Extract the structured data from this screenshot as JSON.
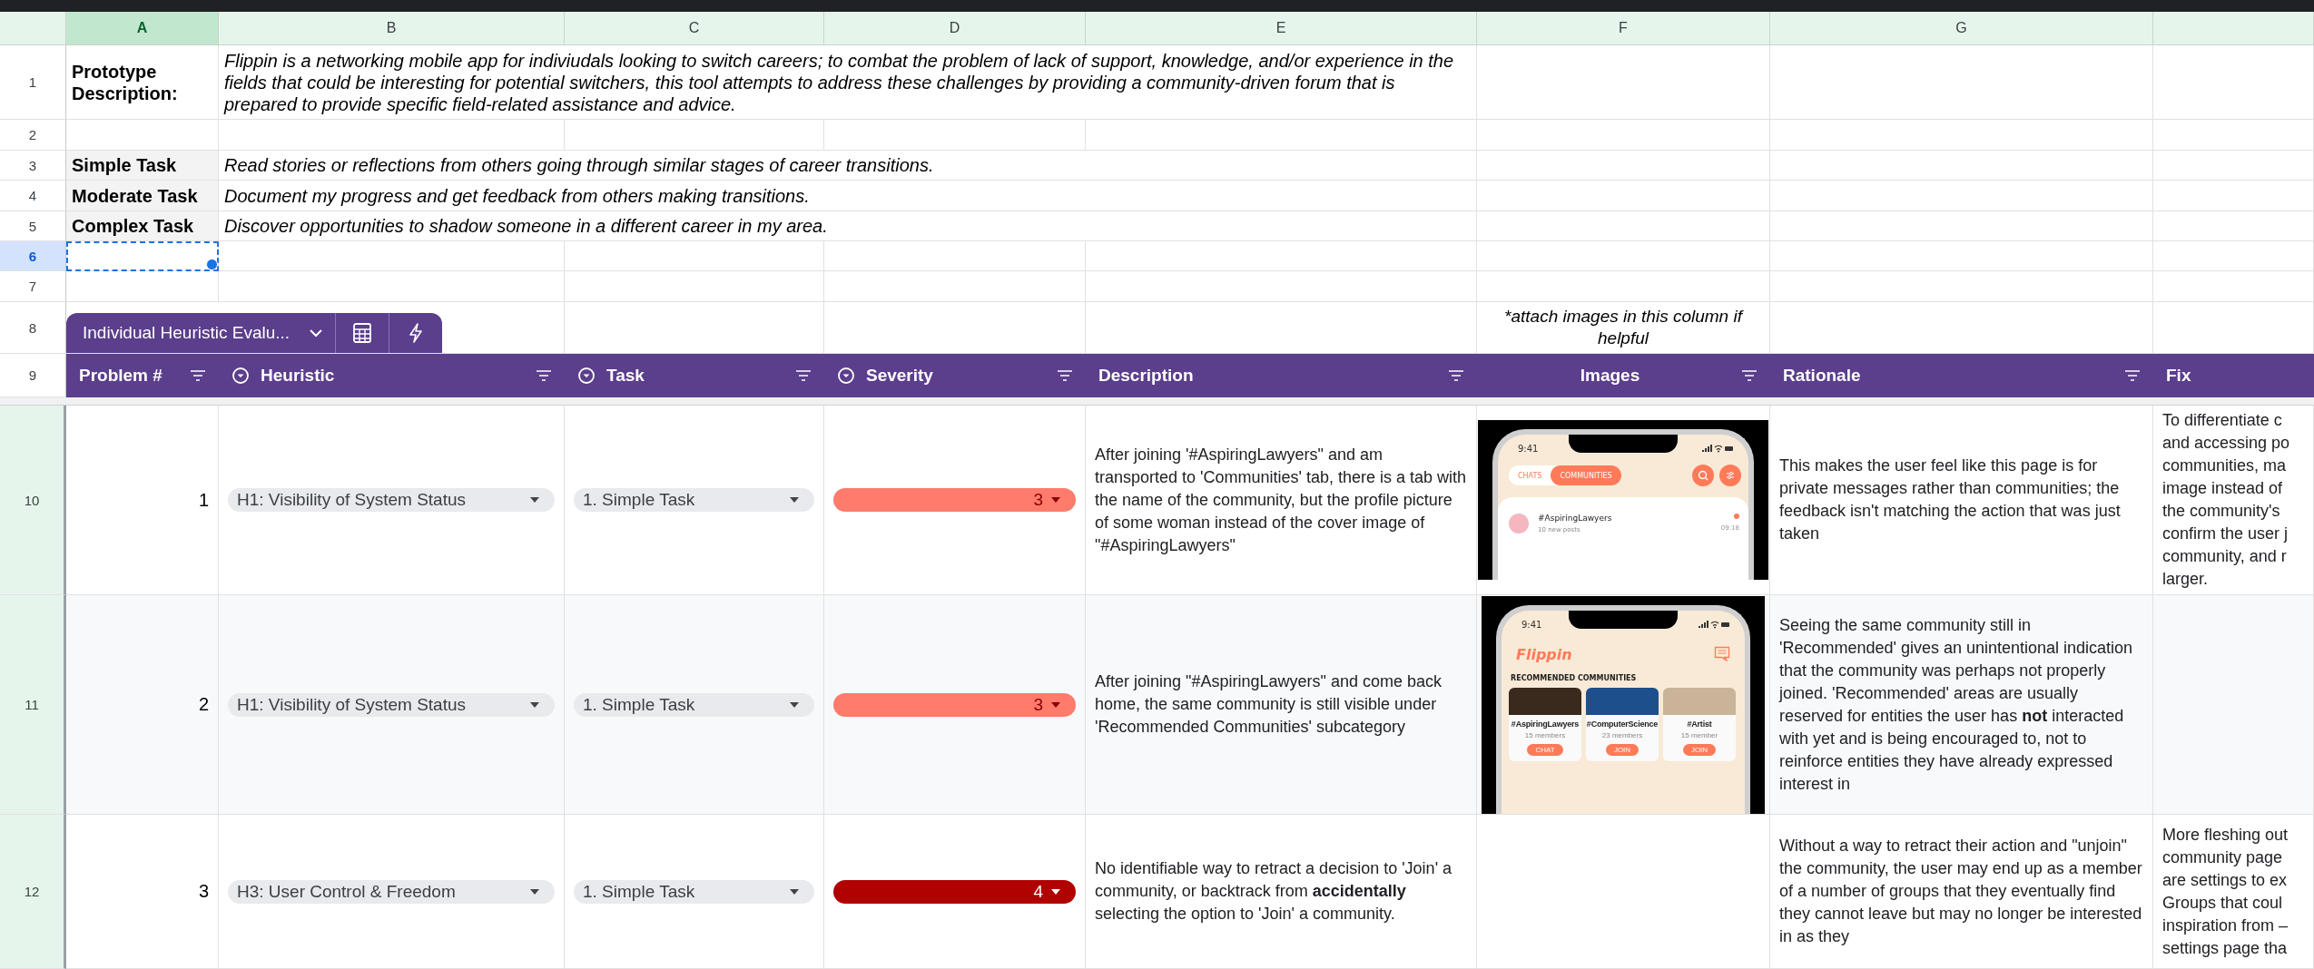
{
  "sheet": {
    "columns": [
      {
        "label": "A",
        "selected": true
      },
      {
        "label": "B",
        "selected": false
      },
      {
        "label": "C",
        "selected": false
      },
      {
        "label": "D",
        "selected": false
      },
      {
        "label": "E",
        "selected": false
      },
      {
        "label": "F",
        "selected": false
      },
      {
        "label": "G",
        "selected": false
      }
    ],
    "row_numbers": [
      {
        "label": "1",
        "selected": false
      },
      {
        "label": "2",
        "selected": false
      },
      {
        "label": "3",
        "selected": false
      },
      {
        "label": "4",
        "selected": false
      },
      {
        "label": "5",
        "selected": false
      },
      {
        "label": "6",
        "selected": true
      },
      {
        "label": "7",
        "selected": false
      },
      {
        "label": "8",
        "selected": false
      },
      {
        "label": "9",
        "selected": false
      },
      {
        "label": "10",
        "selected": false
      },
      {
        "label": "11",
        "selected": false
      },
      {
        "label": "12",
        "selected": false
      }
    ]
  },
  "intro": {
    "label": "Prototype Description:",
    "text": "Flippin is a networking mobile app for indiviudals looking to switch careers; to combat the problem of lack of support, knowledge, and/or experience in the fields that could be interesting for potential switchers, this tool attempts to address these challenges by providing a community-driven forum that is prepared to provide specific field-related assistance and advice."
  },
  "tasks": [
    {
      "label": "Simple Task",
      "text": "Read stories or reflections from others going through similar stages of career transitions."
    },
    {
      "label": "Moderate Task",
      "text": "Document my progress and get feedback from others making transitions."
    },
    {
      "label": "Complex Task",
      "text": "Discover opportunities to shadow someone in a different career in my area."
    }
  ],
  "image_note": "*attach images in this column if helpful",
  "table": {
    "name": "Individual Heuristic Evalu...",
    "columns": [
      {
        "label": "Problem #",
        "kind": "number",
        "filter": true
      },
      {
        "label": "Heuristic",
        "kind": "dropdown",
        "filter": true
      },
      {
        "label": "Task",
        "kind": "dropdown",
        "filter": true
      },
      {
        "label": "Severity",
        "kind": "dropdown",
        "filter": true
      },
      {
        "label": "Description",
        "kind": "text",
        "filter": true
      },
      {
        "label": "Images",
        "kind": "image",
        "filter": true
      },
      {
        "label": "Rationale",
        "kind": "text",
        "filter": true
      },
      {
        "label": "Fix",
        "kind": "text",
        "filter": false
      }
    ],
    "rows": [
      {
        "problem": "1",
        "heuristic": "H1: Visibility of System Status",
        "task": "1. Simple Task",
        "severity": {
          "value": "3",
          "color": "#ff7b6b"
        },
        "description": "After joining '#AspiringLawyers\" and am transported to 'Communities' tab, there is a tab with the name of the community, but the profile picture of some woman instead of the cover image of \"#AspiringLawyers\"",
        "image": {
          "kind": "chats",
          "time": "9:41",
          "tabs": [
            {
              "label": "CHATS",
              "selected": false
            },
            {
              "label": "COMMUNITIES",
              "selected": true
            }
          ],
          "chat": {
            "name": "#AspiringLawyers",
            "subtitle": "10 new posts",
            "time": "09:18",
            "unread": true
          }
        },
        "rationale": "This makes the user feel like this page is for private messages rather than communities; the feedback isn't matching the action that was just taken",
        "fix": "To differentiate c\nand accessing po\ncommunities, ma\nimage instead of\nthe community's\nconfirm the user j\ncommunity, and r\nlarger."
      },
      {
        "problem": "2",
        "heuristic": "H1: Visibility of System Status",
        "task": "1. Simple Task",
        "severity": {
          "value": "3",
          "color": "#ff7b6b"
        },
        "description": "After joining \"#AspiringLawyers\" and come back home, the same community is still visible under 'Recommended Communities' subcategory",
        "image": {
          "kind": "home",
          "time": "9:41",
          "logo": "Flippin",
          "section": "RECOMMENDED COMMUNITIES",
          "cards": [
            {
              "name": "#AspiringLawyers",
              "members": "15 members",
              "action": "CHAT"
            },
            {
              "name": "#ComputerScience",
              "members": "23 members",
              "action": "JOIN"
            },
            {
              "name": "#Artist",
              "members": "15 member",
              "action": "JOIN"
            }
          ]
        },
        "rationale": "Seeing the same community still in 'Recommended' gives an unintentional indication that the community was perhaps not properly joined. 'Recommended' areas are usually reserved for entities the user has **not** interacted with yet and is being encouraged to, not to reinforce entities they have already expressed interest in"
      },
      {
        "problem": "3",
        "heuristic": "H3: User Control & Freedom",
        "task": "1. Simple Task",
        "severity": {
          "value": "4",
          "color": "#b10202"
        },
        "description": "No identifiable way to retract a decision to 'Join' a community, or backtrack from **accidentally** selecting the option to 'Join' a community.",
        "rationale": "Without a way to retract their action and \"unjoin\" the community, the user may end up as a member of a number of groups that they eventually find they cannot leave but may no longer be interested in as they",
        "fix": "More fleshing out\ncommunity page\nare settings to ex\nGroups that coul\ninspiration from –\nsettings page tha"
      }
    ]
  }
}
